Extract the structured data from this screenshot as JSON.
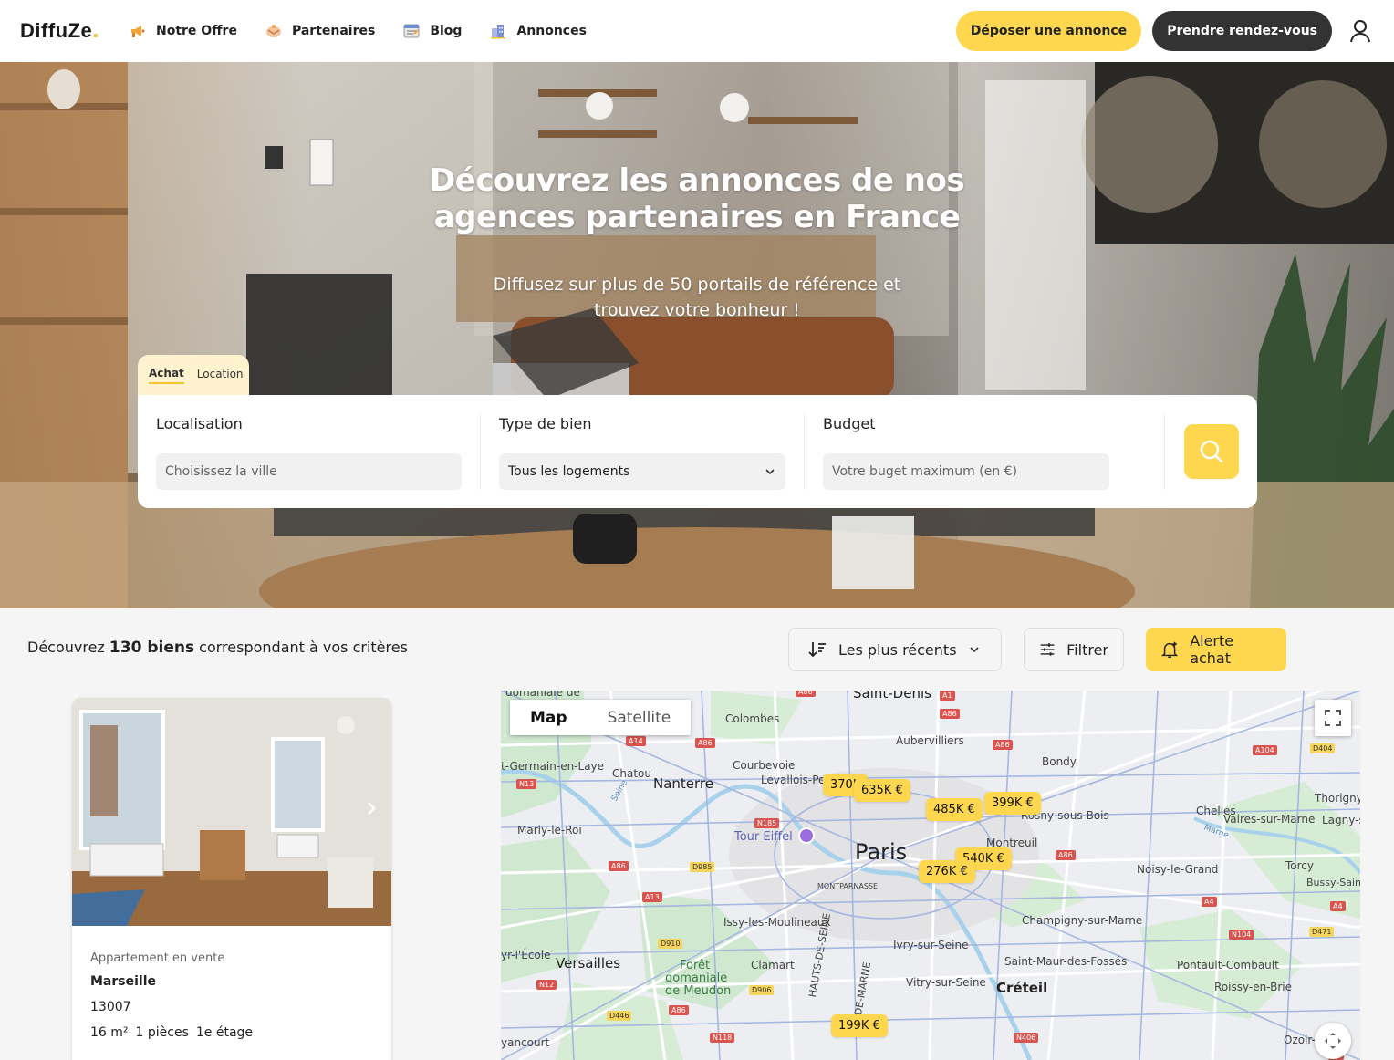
{
  "nav": {
    "logo": "DiffuZe",
    "links": [
      {
        "label": "Notre Offre",
        "icon": "megaphone-icon"
      },
      {
        "label": "Partenaires",
        "icon": "handshake-icon"
      },
      {
        "label": "Blog",
        "icon": "blog-icon"
      },
      {
        "label": "Annonces",
        "icon": "buildings-icon"
      }
    ],
    "cta_primary": "Déposer une annonce",
    "cta_secondary": "Prendre rendez-vous",
    "user_icon": "user-icon",
    "colors": {
      "accent": "#fed74f",
      "dark": "#333333"
    }
  },
  "hero": {
    "title_line1": "Découvrez les annonces de nos",
    "title_line2": "agences partenaires en France",
    "subtitle_line1": "Diffusez sur plus de 50 portails de référence et",
    "subtitle_line2": "trouvez votre bonheur !"
  },
  "search": {
    "tabs": [
      {
        "label": "Achat",
        "active": true
      },
      {
        "label": "Location",
        "active": false
      }
    ],
    "location": {
      "label": "Localisation",
      "placeholder": "Choisissez la ville"
    },
    "type": {
      "label": "Type de bien",
      "value": "Tous les logements"
    },
    "budget": {
      "label": "Budget",
      "placeholder": "Votre buget maximum (en €)"
    }
  },
  "results": {
    "prefix": "Découvrez ",
    "count": "130 biens",
    "suffix": " correspondant à vos critères",
    "sort_label": "Les plus récents",
    "filter_label": "Filtrer",
    "alert_label": "Alerte achat"
  },
  "listing": {
    "type": "Appartement en vente",
    "city": "Marseille",
    "zip": "13007",
    "area": "16 m²",
    "rooms": "1 pièces",
    "floor": "1e étage"
  },
  "map": {
    "toggle_map": "Map",
    "toggle_satellite": "Satellite",
    "city": "Paris",
    "labels": {
      "saint_denis": "Saint-Denis",
      "domaniale": "domaniale de",
      "colombes": "Colombes",
      "aubervilliers": "Aubervilliers",
      "bondy": "Bondy",
      "courbevoie": "Courbevoie",
      "st_germain": "t-Germain-en-Laye",
      "chatou": "Chatou",
      "nanterre": "Nanterre",
      "levallois": "Levallois-Per",
      "chelles": "Chelles",
      "thorigny": "Thorigny-",
      "rosny": "Rosny-sous-Bois",
      "vaires": "Vaires-sur-Marne",
      "lagny": "Lagny-s",
      "marly": "Marly-le-Roi",
      "tour_eiffel": "Tour Eiffel",
      "montreuil": "Montreuil",
      "torcy": "Torcy",
      "noisy": "Noisy-le-Grand",
      "bussy": "Bussy-Saint-G",
      "montparnasse": "MONTPARNASSE",
      "issy": "Issy-les-Moulineaux",
      "champigny": "Champigny-sur-Marne",
      "ecole": "yr-l'École",
      "versailles": "Versailles",
      "foret": "Forêt",
      "domaniale2": "domaniale",
      "meudon": "de Meudon",
      "clamart": "Clamart",
      "ivry": "Ivry-sur-Seine",
      "st_maur": "Saint-Maur-des-Fossés",
      "pontault": "Pontault-Combault",
      "vitry": "Vitry-sur-Seine",
      "creteil": "Créteil",
      "roissy": "Roissy-en-Brie",
      "hauts_de_seine": "HAUTS-DE-SEINE",
      "val_de_marne": "DE-MARNE",
      "guyancourt": "yancourt",
      "ozoir": "Ozoir-la-F",
      "seine": "Seine",
      "marne": "Marne"
    },
    "pins": [
      "370K",
      "635K €",
      "485K €",
      "399K €",
      "540K €",
      "276K €",
      "199K €"
    ]
  }
}
